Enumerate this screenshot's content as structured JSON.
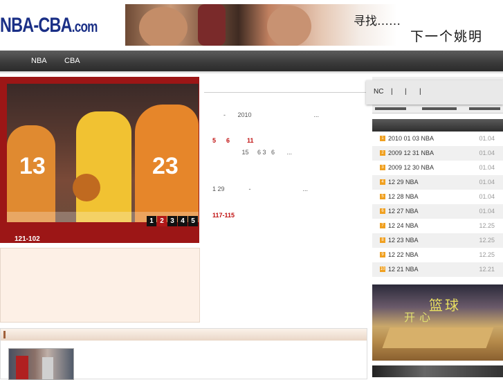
{
  "header": {
    "logo_main": "NBA-CBA",
    "logo_suffix": ".com",
    "banner_line1": "寻找……",
    "banner_line2": "下一个姚明"
  },
  "nav": {
    "items": [
      "NBA",
      "CBA"
    ]
  },
  "slideshow": {
    "caption": "121-102",
    "pages": [
      "1",
      "2",
      "3",
      "4",
      "5"
    ],
    "active_page": "2",
    "jerseys": [
      "13",
      "23"
    ]
  },
  "news": [
    {
      "text": "-       2010                                    ..."
    },
    {
      "text": "5      6          11",
      "red": true
    },
    {
      "text": "                 15     6 3   6       ..."
    },
    {
      "text": "1 29              -                              ..."
    },
    {
      "text": "117-115",
      "red": true
    }
  ],
  "toolbar": {
    "items": [
      "NC",
      "|",
      "|",
      "|"
    ]
  },
  "sidebar_list": [
    {
      "num": "1",
      "title": "2010 01 03 NBA",
      "date": "01.04"
    },
    {
      "num": "2",
      "title": "2009 12 31 NBA",
      "date": "01.04"
    },
    {
      "num": "3",
      "title": "2009 12 30 NBA",
      "date": "01.04"
    },
    {
      "num": "4",
      "title": "12 29 NBA",
      "date": "01.04"
    },
    {
      "num": "5",
      "title": "12 28 NBA",
      "date": "01.04"
    },
    {
      "num": "6",
      "title": "12 27 NBA",
      "date": "01.04"
    },
    {
      "num": "7",
      "title": "12 24 NBA",
      "date": "12.25"
    },
    {
      "num": "8",
      "title": "12 23 NBA",
      "date": "12.25"
    },
    {
      "num": "9",
      "title": "12 22 NBA",
      "date": "12.25"
    },
    {
      "num": "10",
      "title": "12 21 NBA",
      "date": "12.21"
    }
  ],
  "promo": {
    "line1": "篮球",
    "line2": "开心"
  }
}
